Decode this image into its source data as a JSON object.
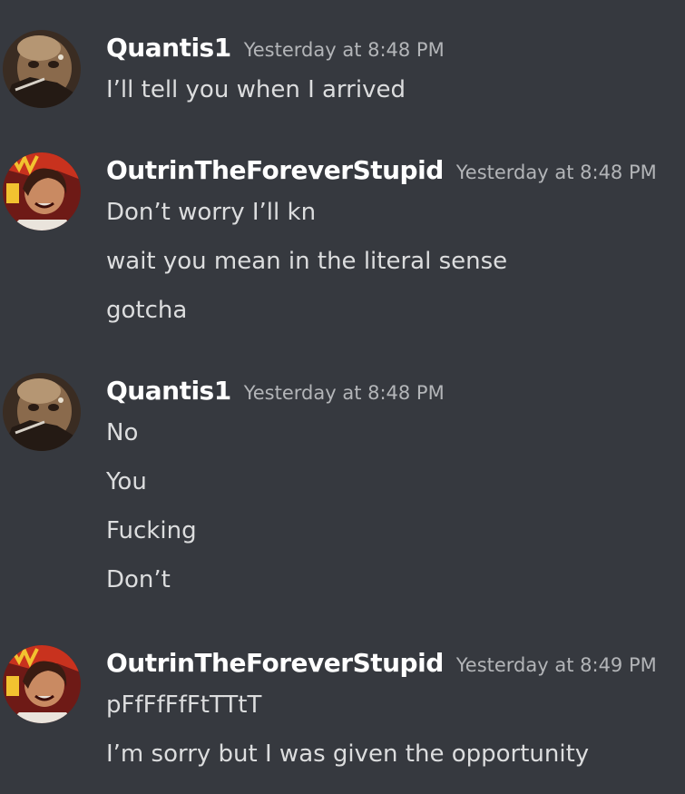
{
  "messages": [
    {
      "author": "Quantis1",
      "avatar": "quantis1-avatar",
      "timestamp": "Yesterday at 8:48 PM",
      "lines": [
        "I’ll tell you when I arrived"
      ]
    },
    {
      "author": "OutrinTheForeverStupid",
      "avatar": "outrin-avatar",
      "timestamp": "Yesterday at 8:48 PM",
      "lines": [
        "Don’t worry I’ll kn",
        "wait you mean in the literal sense",
        "gotcha"
      ]
    },
    {
      "author": "Quantis1",
      "avatar": "quantis1-avatar",
      "timestamp": "Yesterday at 8:48 PM",
      "lines": [
        "No",
        "You",
        "Fucking",
        "Don’t"
      ]
    },
    {
      "author": "OutrinTheForeverStupid",
      "avatar": "outrin-avatar",
      "timestamp": "Yesterday at 8:49 PM",
      "lines": [
        "pFfFfFfFtTTtT",
        "I’m sorry but I was given the opportunity"
      ]
    }
  ],
  "colors": {
    "background": "#36393f",
    "username": "#ffffff",
    "timestamp": "#b3b5b8",
    "message_text": "#dcddde"
  }
}
